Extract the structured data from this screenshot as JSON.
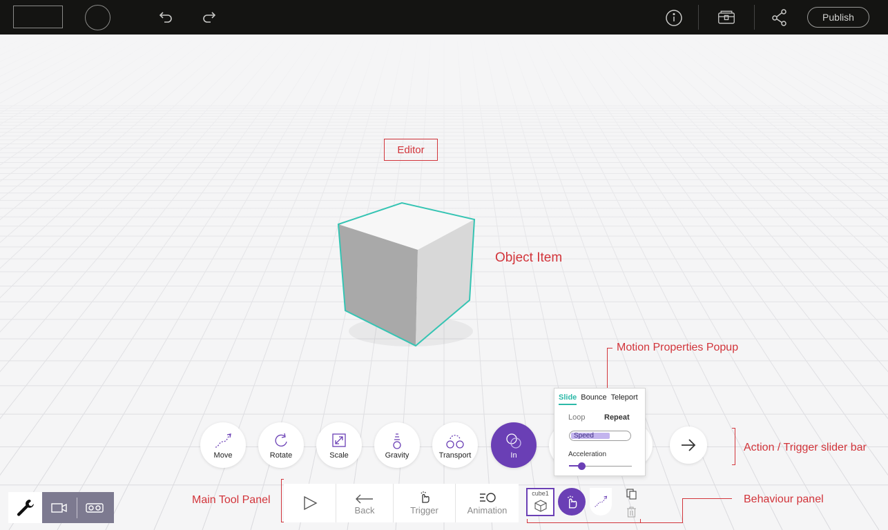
{
  "topbar": {
    "publish_label": "Publish",
    "icons": [
      "undo-icon",
      "redo-icon",
      "info-icon",
      "treasure-chest-icon",
      "share-icon"
    ]
  },
  "annotations": {
    "editor": "Editor",
    "object_item": "Object Item",
    "motion_popup": "Motion Properties Popup",
    "action_bar": "Action / Trigger slider bar",
    "main_tool_panel": "Main Tool Panel",
    "behaviour_panel": "Behaviour panel"
  },
  "actions": [
    {
      "label": "Move",
      "icon": "move-path-icon"
    },
    {
      "label": "Rotate",
      "icon": "rotate-icon"
    },
    {
      "label": "Scale",
      "icon": "scale-icon"
    },
    {
      "label": "Gravity",
      "icon": "gravity-icon"
    },
    {
      "label": "Transport",
      "icon": "transport-icon"
    },
    {
      "label": "In",
      "icon": "in-icon",
      "active": true
    }
  ],
  "popup": {
    "tabs": [
      "Slide",
      "Bounce",
      "Teleport"
    ],
    "active_tab": "Slide",
    "loop_label": "Loop",
    "repeat_label": "Repeat",
    "speed_label": "Speed",
    "speed_value": 0.65,
    "acceleration_label": "Acceleration",
    "acceleration_value": 0.2
  },
  "main_panel": {
    "play_icon": "play-icon",
    "back_label": "Back",
    "trigger_label": "Trigger",
    "animation_label": "Animation"
  },
  "behaviour": {
    "object_name": "cube1"
  },
  "colors": {
    "accent": "#6a3fb5",
    "teal": "#2cb9a8",
    "annotation": "#d2343a",
    "topbar": "#141412"
  }
}
